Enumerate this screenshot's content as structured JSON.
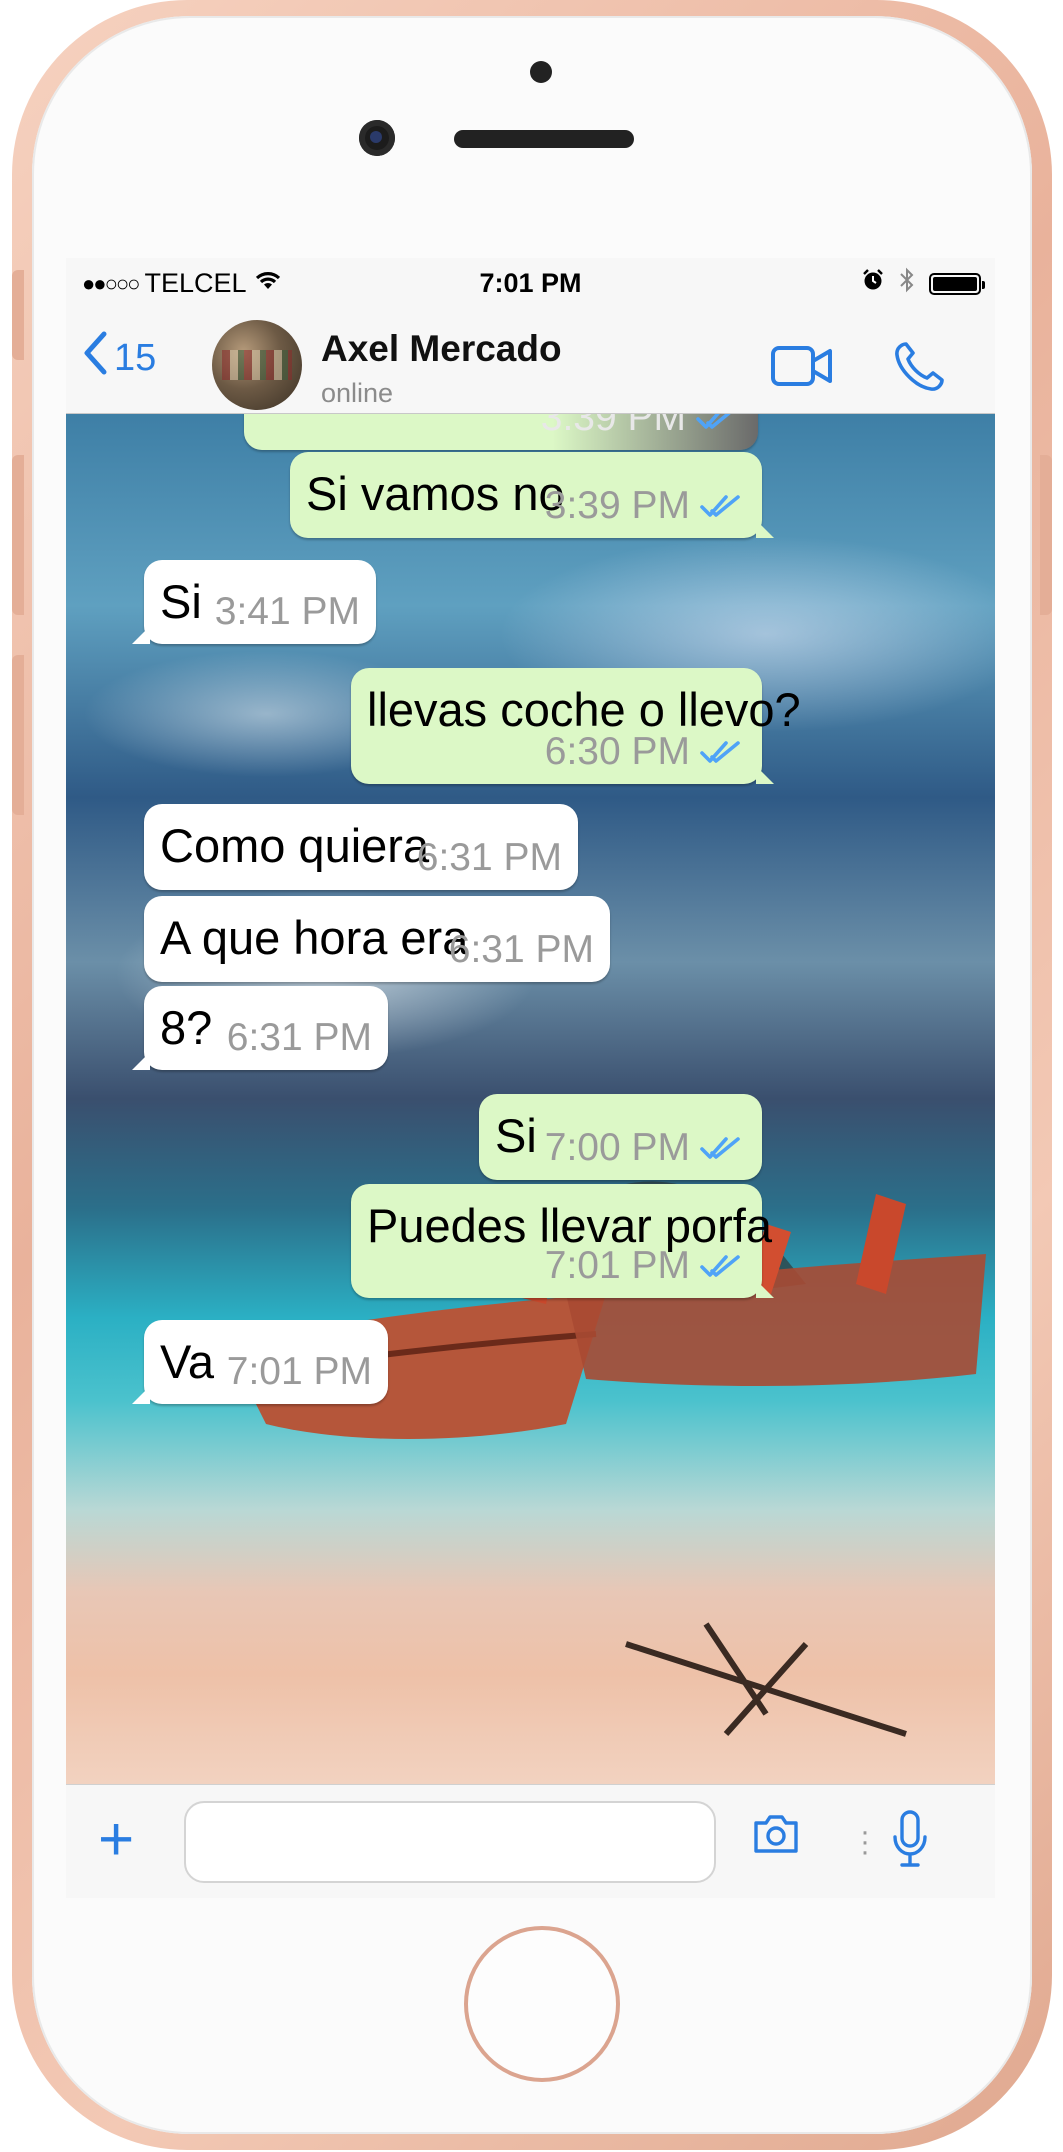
{
  "status_bar": {
    "signal_dots": "●●○○○",
    "carrier": "TELCEL",
    "time": "7:01 PM"
  },
  "header": {
    "back_count": "15",
    "contact_name": "Axel Mercado",
    "contact_status": "online"
  },
  "messages": [
    {
      "direction": "out",
      "text": "",
      "time": "3:39 PM",
      "read": true
    },
    {
      "direction": "out",
      "text": "Si vamos no",
      "time": "3:39 PM",
      "read": true
    },
    {
      "direction": "in",
      "text": "Si",
      "time": "3:41 PM"
    },
    {
      "direction": "out",
      "text": "llevas coche o llevo?",
      "time": "6:30 PM",
      "read": true
    },
    {
      "direction": "in",
      "text": "Como quiera",
      "time": "6:31 PM"
    },
    {
      "direction": "in",
      "text": "A que hora era",
      "time": "6:31 PM"
    },
    {
      "direction": "in",
      "text": "8?",
      "time": "6:31 PM"
    },
    {
      "direction": "out",
      "text": "Si",
      "time": "7:00 PM",
      "read": true
    },
    {
      "direction": "out",
      "text": "Puedes llevar porfa",
      "time": "7:01 PM",
      "read": true
    },
    {
      "direction": "in",
      "text": "Va",
      "time": "7:01 PM"
    }
  ],
  "input": {
    "placeholder": ""
  },
  "colors": {
    "accent": "#2a7de1",
    "bubble_out": "#dcf8c6",
    "bubble_in": "#ffffff",
    "read_ticks": "#4fa3f7",
    "phone_frame": "#eab59f"
  },
  "icons": [
    "wifi-icon",
    "alarm-icon",
    "bluetooth-icon",
    "battery-icon",
    "back-chevron-icon",
    "video-call-icon",
    "phone-call-icon",
    "plus-icon",
    "camera-icon",
    "microphone-icon",
    "double-check-icon"
  ]
}
